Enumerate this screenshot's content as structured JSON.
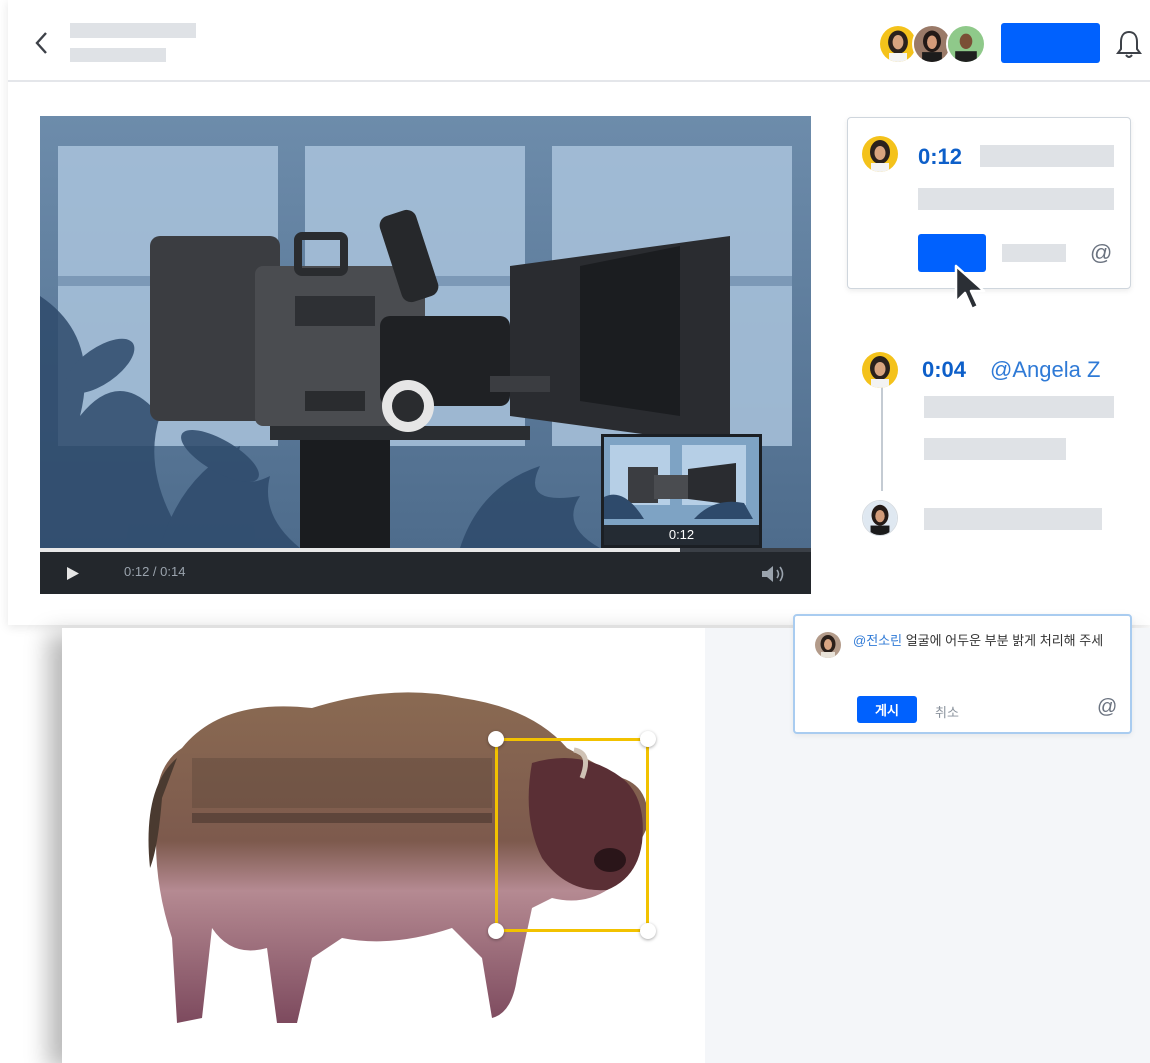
{
  "video": {
    "current_time": "0:12",
    "duration": "0:14",
    "time_display": "0:12 / 0:14",
    "progress": 0.83,
    "thumbnail_time": "0:12"
  },
  "comments": {
    "active": {
      "timestamp": "0:12"
    },
    "thread": {
      "timestamp": "0:04",
      "mention": "@Angela Z"
    }
  },
  "image_comment": {
    "mention": "@전소린",
    "text": " 얼굴에 어두운 부분 밝게 처리해 주세",
    "post_label": "게시",
    "cancel_label": "취소"
  },
  "icons": {
    "back": "chevron-left-icon",
    "notifications": "bell-icon",
    "mention": "at-icon",
    "play": "play-icon",
    "volume": "volume-icon",
    "cursor": "mouse-pointer-icon"
  },
  "colors": {
    "primary_blue": "#0061fe",
    "timestamp_blue": "#0d5fc9",
    "mention_blue": "#2f7ad6",
    "selection_yellow": "#f2c200",
    "placeholder_gray": "#dfe2e6"
  }
}
